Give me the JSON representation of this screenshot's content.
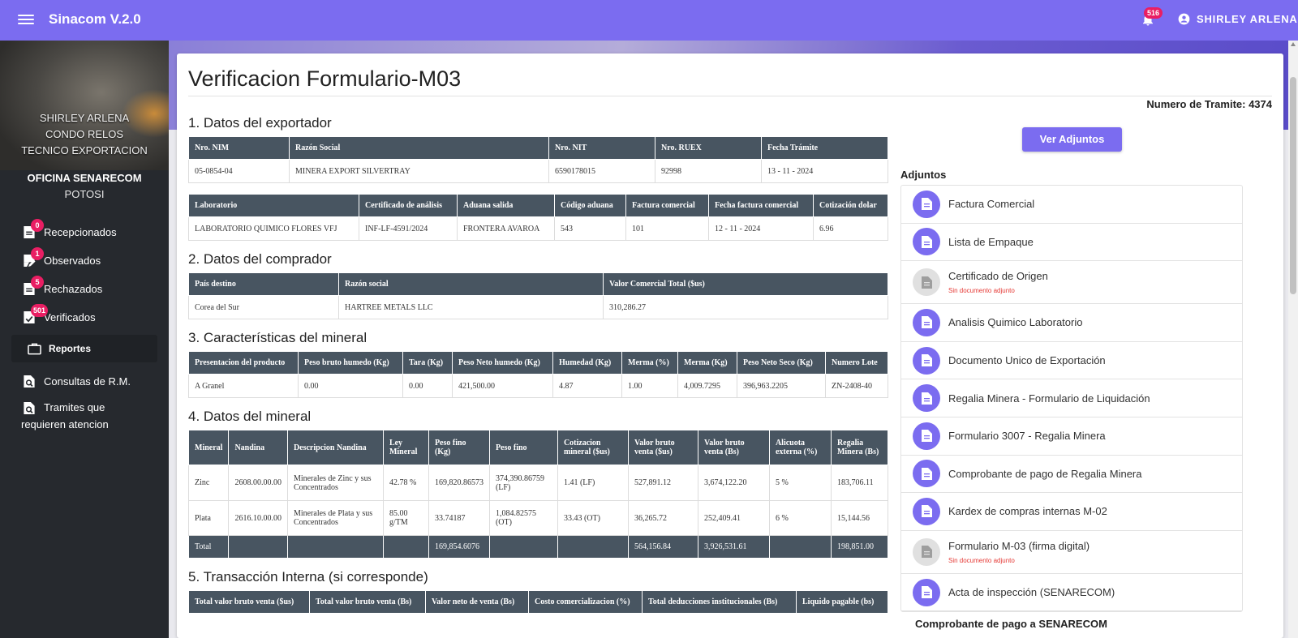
{
  "app": {
    "title": "Sinacom V.2.0",
    "notification_count": "516",
    "user": "SHIRLEY ARLENA"
  },
  "sidebar": {
    "user_name": "SHIRLEY ARLENA CONDO RELOS",
    "role": "TECNICO EXPORTACION",
    "office": "OFICINA SENARECOM",
    "city": "POTOSI",
    "nav": [
      {
        "label": "Recepcionados",
        "badge": "0"
      },
      {
        "label": "Observados",
        "badge": "1"
      },
      {
        "label": "Rechazados",
        "badge": "5"
      },
      {
        "label": "Verificados",
        "badge": "501"
      }
    ],
    "reportes": "Reportes",
    "consultas": "Consultas de R.M.",
    "tramites": "Tramites que requieren atencion"
  },
  "page": {
    "title": "Verificacion Formulario-M03",
    "tramite": "Numero de Tramite: 4374"
  },
  "sections": {
    "s1": "1. Datos del exportador",
    "s2": "2. Datos del comprador",
    "s3": "3. Características del mineral",
    "s4": "4. Datos del mineral",
    "s5": "5. Transacción Interna (si corresponde)"
  },
  "exportador": {
    "headers": [
      "Nro. NIM",
      "Razón Social",
      "Nro. NIT",
      "Nro. RUEX",
      "Fecha Trámite"
    ],
    "row": [
      "05-0854-04",
      "MINERA EXPORT SILVERTRAY",
      "6590178015",
      "92998",
      "13 - 11 - 2024"
    ]
  },
  "laboratorio": {
    "headers": [
      "Laboratorio",
      "Certificado de análisis",
      "Aduana salida",
      "Código aduana",
      "Factura comercial",
      "Fecha factura comercial",
      "Cotización dolar"
    ],
    "row": [
      "LABORATORIO QUIMICO FLORES VFJ",
      "INF-LF-4591/2024",
      "FRONTERA AVAROA",
      "543",
      "101",
      "12 - 11 - 2024",
      "6.96"
    ]
  },
  "comprador": {
    "headers": [
      "País destino",
      "Razón social",
      "Valor Comercial Total ($us)"
    ],
    "row": [
      "Corea del Sur",
      "HARTREE METALS LLC",
      "310,286.27"
    ]
  },
  "caracteristicas": {
    "headers": [
      "Presentacion del producto",
      "Peso bruto humedo (Kg)",
      "Tara (Kg)",
      "Peso Neto humedo (Kg)",
      "Humedad (Kg)",
      "Merma (%)",
      "Merma (Kg)",
      "Peso Neto Seco (Kg)",
      "Numero Lote"
    ],
    "row": [
      "A Granel",
      "0.00",
      "0.00",
      "421,500.00",
      "4.87",
      "1.00",
      "4,009.7295",
      "396,963.2205",
      "ZN-2408-40"
    ]
  },
  "mineral": {
    "headers": [
      "Mineral",
      "Nandina",
      "Descripcion Nandina",
      "Ley Mineral",
      "Peso fino (Kg)",
      "Peso fino",
      "Cotizacion mineral ($us)",
      "Valor bruto venta ($us)",
      "Valor bruto venta (Bs)",
      "Alicuota externa (%)",
      "Regalia Minera (Bs)"
    ],
    "rows": [
      [
        "Zinc",
        "2608.00.00.00",
        "Minerales de Zinc y sus Concentrados",
        "42.78 %",
        "169,820.86573",
        "374,390.86759 (LF)",
        "1.41 (LF)",
        "527,891.12",
        "3,674,122.20",
        "5 %",
        "183,706.11"
      ],
      [
        "Plata",
        "2616.10.00.00",
        "Minerales de Plata y sus Concentrados",
        "85.00 g/TM",
        "33.74187",
        "1,084.82575 (OT)",
        "33.43 (OT)",
        "36,265.72",
        "252,409.41",
        "6 %",
        "15,144.56"
      ]
    ],
    "total": [
      "Total",
      "",
      "",
      "",
      "169,854.6076",
      "",
      "",
      "564,156.84",
      "3,926,531.61",
      "",
      "198,851.00"
    ]
  },
  "transaccion": {
    "headers": [
      "Total valor bruto venta ($us)",
      "Total valor bruto venta (Bs)",
      "Valor neto de venta (Bs)",
      "Costo comercializacion (%)",
      "Total deducciones institucionales (Bs)",
      "Liquido pagable (bs)"
    ]
  },
  "adjuntos": {
    "button": "Ver Adjuntos",
    "title": "Adjuntos",
    "missing_text": "Sin documento adjunto",
    "items": [
      {
        "label": "Factura Comercial",
        "missing": false
      },
      {
        "label": "Lista de Empaque",
        "missing": false
      },
      {
        "label": "Certificado de Origen",
        "missing": true
      },
      {
        "label": "Analisis Quimico Laboratorio",
        "missing": false
      },
      {
        "label": "Documento Unico de Exportación",
        "missing": false
      },
      {
        "label": "Regalia Minera - Formulario de Liquidación",
        "missing": false
      },
      {
        "label": "Formulario 3007 - Regalia Minera",
        "missing": false
      },
      {
        "label": "Comprobante de pago de Regalia Minera",
        "missing": false
      },
      {
        "label": "Kardex de compras internas M-02",
        "missing": false
      },
      {
        "label": "Formulario M-03 (firma digital)",
        "missing": true
      },
      {
        "label": "Acta de inspección (SENARECOM)",
        "missing": false
      }
    ],
    "footer": "Comprobante de pago a SENARECOM"
  },
  "colors": {
    "primary": "#7b6cf0",
    "sidebar": "#26292e",
    "table_header": "#485561",
    "badge": "#e91e63"
  }
}
